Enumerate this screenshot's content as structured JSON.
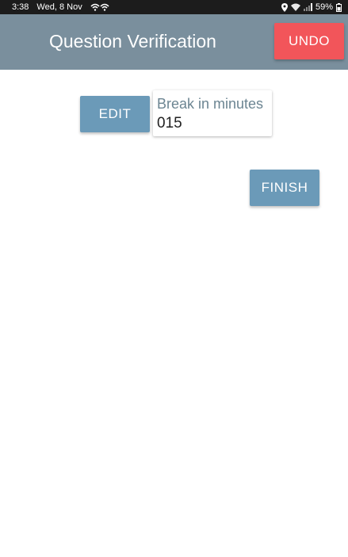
{
  "status_bar": {
    "time": "3:38",
    "date": "Wed, 8 Nov",
    "battery": "59%",
    "icons": [
      "wifi-calling-icon",
      "location-icon",
      "wifi-icon",
      "signal-icon",
      "battery-icon"
    ]
  },
  "app_bar": {
    "title": "Question Verification",
    "undo_label": "UNDO",
    "background_color": "#7a8f9d",
    "undo_color": "#f2555a"
  },
  "main": {
    "edit_label": "EDIT",
    "break_field": {
      "label": "Break in minutes",
      "value": "015"
    },
    "finish_label": "FINISH",
    "button_color": "#6b9ab8"
  }
}
